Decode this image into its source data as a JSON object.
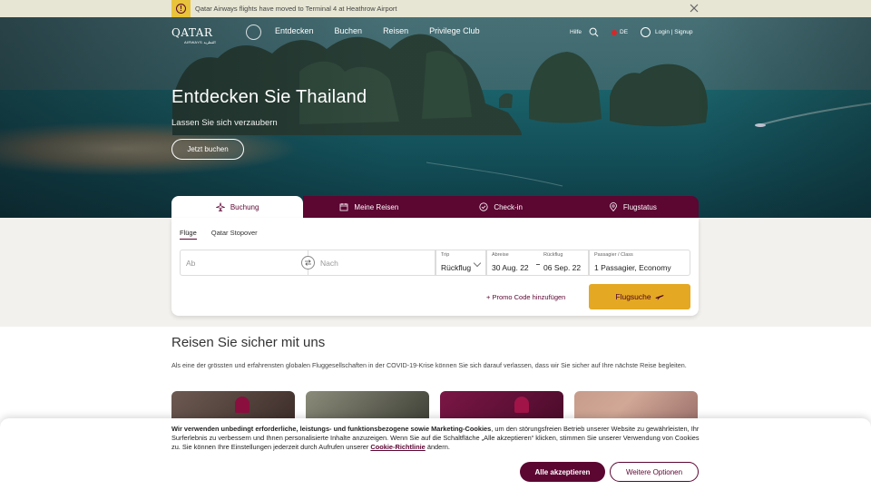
{
  "notice": {
    "text": "Qatar Airways flights have moved to Terminal 4 at Heathrow Airport",
    "icon": "info-icon",
    "close_icon": "close-icon"
  },
  "nav": {
    "logo_word": "QATAR",
    "logo_sub": "AIRWAYS القطرية",
    "links": [
      "Entdecken",
      "Buchen",
      "Reisen",
      "Privilege Club"
    ],
    "help": "Hilfe",
    "language": "DE",
    "login": "Login | Signup"
  },
  "hero": {
    "title": "Entdecken Sie Thailand",
    "subtitle": "Lassen Sie sich verzaubern",
    "cta": "Jetzt buchen"
  },
  "booking": {
    "tabs": [
      {
        "label": "Buchung",
        "icon": "plane-icon",
        "active": true
      },
      {
        "label": "Meine Reisen",
        "icon": "calendar-icon",
        "active": false
      },
      {
        "label": "Check-in",
        "icon": "check-circle-icon",
        "active": false
      },
      {
        "label": "Flugstatus",
        "icon": "location-pin-icon",
        "active": false
      }
    ],
    "subtabs": [
      "Flüge",
      "Qatar Stopover"
    ],
    "from_placeholder": "Ab",
    "to_placeholder": "Nach",
    "trip_label": "Trip",
    "trip_value": "Rückflug",
    "depart_label": "Abreise",
    "depart_value": "30 Aug. 22",
    "return_label": "Rückflug",
    "return_value": "06 Sep. 22",
    "pax_label": "Passagier / Class",
    "pax_value": "1 Passagier, Economy",
    "promo": "+ Promo Code hinzufügen",
    "search": "Flugsuche"
  },
  "section": {
    "title": "Reisen Sie sicher mit uns",
    "text": "Als eine der grössten und erfahrensten globalen Fluggesellschaften in der COVID-19-Krise können Sie sich darauf verlassen, dass wir Sie sicher auf Ihre nächste Reise begleiten."
  },
  "cookie": {
    "bold": "Wir verwenden unbedingt erforderliche, leistungs- und funktionsbezogene sowie Marketing-Cookies",
    "text": ", um den störungsfreien Betrieb unserer Website zu gewährleisten, Ihr Surferlebnis zu verbessern und Ihnen personalisierte Inhalte anzuzeigen. Wenn Sie auf die Schaltfläche „Alle akzeptieren“ klicken, stimmen Sie unserer Verwendung von Cookies zu. Sie können Ihre Einstellungen jederzeit durch Aufrufen unserer ",
    "link": "Cookie-Richtlinie",
    "tail": " ändern.",
    "accept": "Alle akzeptieren",
    "more": "Weitere Optionen"
  },
  "colors": {
    "brand": "#5c0632",
    "accent": "#e5a823",
    "notice_bg": "#e7e6d4"
  }
}
